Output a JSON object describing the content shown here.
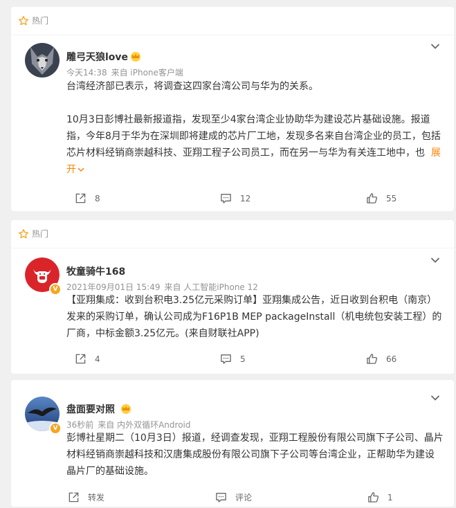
{
  "feed": {
    "posts": [
      {
        "hot_label": "热门",
        "user_name": "雕弓天狼love",
        "meta_time": "今天14:38",
        "meta_source": "来自 iPhone客户端",
        "paragraph1": "台湾经济部已表示，将调查这四家台湾公司与华为的关系。",
        "paragraph2": "10月3日彭博社最新报道指，发现至少4家台湾企业协助华为建设芯片基础设施。报道指，今年8月于华为在深圳即将建成的芯片厂工地，发现多名来自台湾企业的员工，包括芯片材料经销商崇越科技、亚翔工程子公司员工，而在另一与华为有关连工地中，也",
        "expand_label": "展开",
        "repost_count": "8",
        "comment_count": "12",
        "like_count": "55"
      },
      {
        "hot_label": "热门",
        "user_name": "牧童骑牛168",
        "meta_time": "2021年09月01日 15:49",
        "meta_source": "来自 人工智能iPhone 12",
        "paragraph1": "【亚翔集成：收到台积电3.25亿元采购订单】亚翔集成公告，近日收到台积电（南京）发来的采购订单，确认公司成为F16P1B MEP packageInstall（机电统包安装工程）的厂商，中标金额3.25亿元。(来自财联社APP)",
        "repost_count": "4",
        "comment_count": "5",
        "like_count": "66"
      },
      {
        "user_name": "盘面要对照",
        "meta_time": "36秒前",
        "meta_source": "来自 内外双循环Android",
        "paragraph1": "彭博社星期二（10月3日）报道，经调查发现，亚翔工程股份有限公司旗下子公司、晶片材料经销商崇越科技和汉唐集成股份有限公司旗下子公司等台湾企业，正帮助华为建设晶片厂的基础设施。",
        "repost_label": "转发",
        "comment_label": "评论",
        "like_count": "1"
      }
    ]
  },
  "colors": {
    "background": "#f0f0f0",
    "card": "#ffffff",
    "meta_gray": "#939393",
    "expand_orange": "#ff8200",
    "badge_gold": "#f5a623",
    "avatar2_red": "#d9252a"
  },
  "icons": [
    "star-icon",
    "crown-icon",
    "chevron-down-icon",
    "repost-icon",
    "comment-icon",
    "like-icon"
  ]
}
